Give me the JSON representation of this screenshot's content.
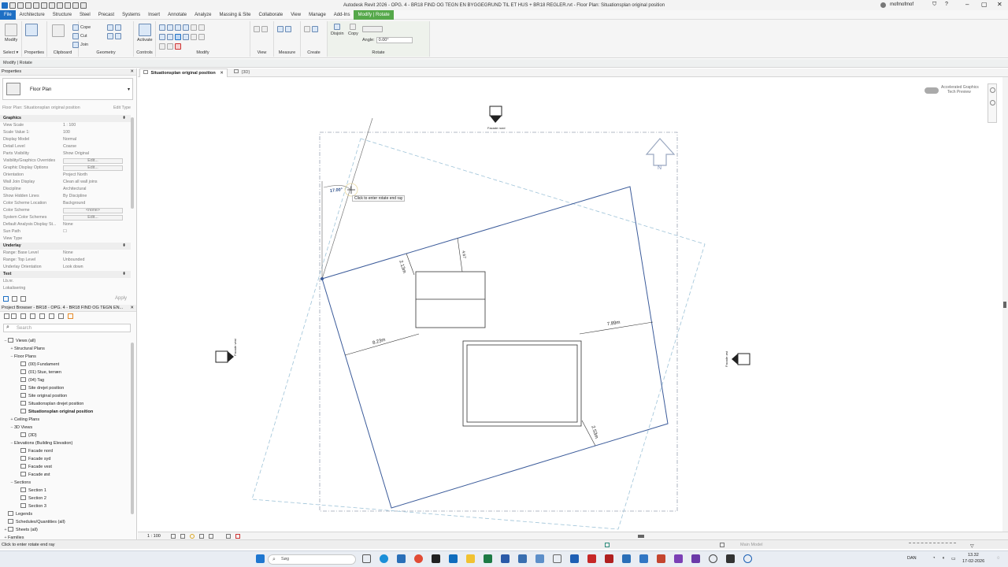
{
  "window": {
    "title": "Autodesk Revit 2026 - OPG. 4 - BR18 FIND OG TEGN EN BYGGEGRUND TIL ET HUS + BR18 REGLER.rvt - Floor Plan: Situationsplan original position",
    "user": "mofmofmof"
  },
  "menu": [
    "File",
    "Architecture",
    "Structure",
    "Steel",
    "Precast",
    "Systems",
    "Insert",
    "Annotate",
    "Analyze",
    "Massing & Site",
    "Collaborate",
    "View",
    "Manage",
    "Add-Ins",
    "Modify | Rotate"
  ],
  "ribbon": {
    "buttons": {
      "modify": "Modify",
      "properties": "Properties",
      "cope": "Cope",
      "cut": "Cut",
      "join": "Join",
      "activate": "Activate",
      "disjoin": "Disjoin",
      "copy": "Copy",
      "angle_label": "Angle:",
      "angle_value": "0.00°"
    },
    "groups": [
      "Select ▾",
      "Properties",
      "Clipboard",
      "Geometry",
      "Controls",
      "Modify",
      "View",
      "Measure",
      "Create",
      "Rotate"
    ]
  },
  "context": "Modify | Rotate",
  "properties": {
    "title": "Properties",
    "type": "Floor Plan",
    "selector": "Floor Plan: Situationsplan original position",
    "edit_type": "Edit Type",
    "apply": "Apply",
    "rows": [
      {
        "k": "Graphics",
        "section": true
      },
      {
        "k": "View Scale",
        "v": "1 : 100"
      },
      {
        "k": "Scale Value    1:",
        "v": "100"
      },
      {
        "k": "Display Model",
        "v": "Normal"
      },
      {
        "k": "Detail Level",
        "v": "Coarse"
      },
      {
        "k": "Parts Visibility",
        "v": "Show Original"
      },
      {
        "k": "Visibility/Graphics Overrides",
        "v": "Edit...",
        "btn": true
      },
      {
        "k": "Graphic Display Options",
        "v": "Edit...",
        "btn": true
      },
      {
        "k": "Orientation",
        "v": "Project North"
      },
      {
        "k": "Wall Join Display",
        "v": "Clean all wall joins"
      },
      {
        "k": "Discipline",
        "v": "Architectural"
      },
      {
        "k": "Show Hidden Lines",
        "v": "By Discipline"
      },
      {
        "k": "Color Scheme Location",
        "v": "Background"
      },
      {
        "k": "Color Scheme",
        "v": "<none>",
        "btn": true
      },
      {
        "k": "System Color Schemes",
        "v": "Edit...",
        "btn": true
      },
      {
        "k": "Default Analysis Display St...",
        "v": "None"
      },
      {
        "k": "Sun Path",
        "v": "☐"
      },
      {
        "k": "View Type",
        "v": ""
      },
      {
        "k": "Underlay",
        "section": true
      },
      {
        "k": "Range: Base Level",
        "v": "None"
      },
      {
        "k": "Range: Top Level",
        "v": "Unbounded"
      },
      {
        "k": "Underlay Orientation",
        "v": "Look down"
      },
      {
        "k": "Text",
        "section": true
      },
      {
        "k": "Lb.nr.",
        "v": ""
      },
      {
        "k": "Lokalisering",
        "v": ""
      }
    ]
  },
  "browser": {
    "title": "Project Browser - BR18 - OPG. 4 - BR18 FIND OG TEGN EN...",
    "search_placeholder": "Search",
    "items": [
      {
        "label": "Views (all)",
        "level": 0,
        "toggle": "−",
        "icon": true
      },
      {
        "label": "Structural Plans",
        "level": 1,
        "toggle": "+"
      },
      {
        "label": "Floor Plans",
        "level": 1,
        "toggle": "−"
      },
      {
        "label": "(00) Fundament",
        "level": 2,
        "icon": true
      },
      {
        "label": "(01) Stue, terræn",
        "level": 2,
        "icon": true
      },
      {
        "label": "(04) Tag",
        "level": 2,
        "icon": true
      },
      {
        "label": "Site drejet position",
        "level": 2,
        "icon": true
      },
      {
        "label": "Site original position",
        "level": 2,
        "icon": true
      },
      {
        "label": "Situationsplan drejet position",
        "level": 2,
        "icon": true
      },
      {
        "label": "Situationsplan original position",
        "level": 2,
        "icon": true,
        "bold": true
      },
      {
        "label": "Ceiling Plans",
        "level": 1,
        "toggle": "+"
      },
      {
        "label": "3D Views",
        "level": 1,
        "toggle": "−"
      },
      {
        "label": "{3D}",
        "level": 2,
        "icon": true
      },
      {
        "label": "Elevations (Building Elevation)",
        "level": 1,
        "toggle": "−"
      },
      {
        "label": "Facade nord",
        "level": 2,
        "icon": true
      },
      {
        "label": "Facade syd",
        "level": 2,
        "icon": true
      },
      {
        "label": "Facade vest",
        "level": 2,
        "icon": true
      },
      {
        "label": "Facade øst",
        "level": 2,
        "icon": true
      },
      {
        "label": "Sections",
        "level": 1,
        "toggle": "−"
      },
      {
        "label": "Section 1",
        "level": 2,
        "icon": true
      },
      {
        "label": "Section 2",
        "level": 2,
        "icon": true
      },
      {
        "label": "Section 3",
        "level": 2,
        "icon": true
      },
      {
        "label": "Legends",
        "level": 0,
        "icon": true
      },
      {
        "label": "Schedules/Quantities (all)",
        "level": 0,
        "icon": true
      },
      {
        "label": "Sheets (all)",
        "level": 0,
        "toggle": "+",
        "icon": true
      },
      {
        "label": "Families",
        "level": 0,
        "toggle": "+"
      }
    ]
  },
  "view_tabs": [
    {
      "label": "Situationsplan original position",
      "active": true
    },
    {
      "label": "{3D}",
      "active": false
    }
  ],
  "canvas": {
    "accel_label_1": "Accelerated Graphics",
    "accel_label_2": "Tech Preview",
    "elev_north": "Facade nord",
    "elev_west": "Facade vest",
    "elev_east": "Facade øst",
    "north_label": "N",
    "angle_dim": "17.00°",
    "tooltip": "Click to enter rotate end ray",
    "dims": [
      "2.13m",
      "4.67",
      "8.23m",
      "7.89m",
      "2.53m"
    ]
  },
  "viewbar": {
    "scale": "1 : 100"
  },
  "status": {
    "left": "Click to enter rotate end ray",
    "model": "Main Model"
  },
  "taskbar": {
    "search": "Søg",
    "lang": "DAN",
    "time": "13.32",
    "date": "17-02-2026"
  }
}
